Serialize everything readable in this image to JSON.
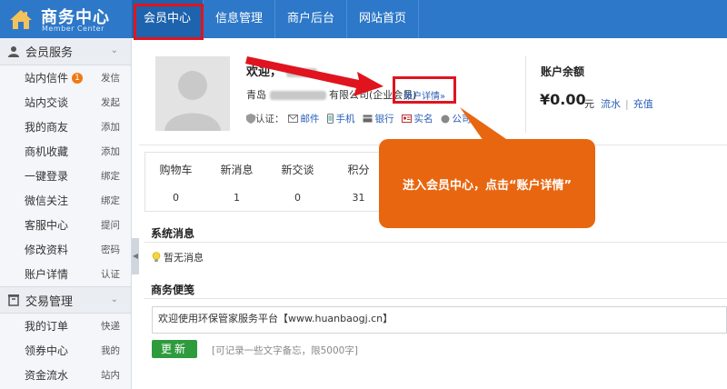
{
  "header": {
    "logo_title": "商务中心",
    "logo_subtitle": "Member Center",
    "tabs": [
      {
        "label": "会员中心",
        "active": true
      },
      {
        "label": "信息管理",
        "active": false
      },
      {
        "label": "商户后台",
        "active": false
      },
      {
        "label": "网站首页",
        "active": false
      }
    ],
    "bg_color": "#2d78c8"
  },
  "sidebar": {
    "sections": [
      {
        "title": "会员服务",
        "items": [
          {
            "label": "站内信件",
            "badge": "1",
            "action": "发信"
          },
          {
            "label": "站内交谈",
            "action": "发起"
          },
          {
            "label": "我的商友",
            "action": "添加"
          },
          {
            "label": "商机收藏",
            "action": "添加"
          },
          {
            "label": "一键登录",
            "action": "绑定"
          },
          {
            "label": "微信关注",
            "action": "绑定"
          },
          {
            "label": "客服中心",
            "action": "提问"
          },
          {
            "label": "修改资料",
            "action": "密码"
          },
          {
            "label": "账户详情",
            "action": "认证"
          }
        ]
      },
      {
        "title": "交易管理",
        "items": [
          {
            "label": "我的订单",
            "action": "快递"
          },
          {
            "label": "领券中心",
            "action": "我的"
          },
          {
            "label": "资金流水",
            "action": "站内"
          }
        ]
      }
    ]
  },
  "profile": {
    "welcome": "欢迎，",
    "company_prefix": "青岛",
    "company_suffix": "有限公司(企业会员)",
    "account_link": "账户详情»",
    "cert_label": "认证：",
    "certs": [
      "邮件",
      "手机",
      "银行",
      "实名",
      "公司"
    ]
  },
  "balance": {
    "title": "账户余额",
    "amount": "¥0.00",
    "unit": "元",
    "link_flow": "流水",
    "separator": "|",
    "link_recharge": "充值"
  },
  "stats": [
    {
      "label": "购物车",
      "value": "0"
    },
    {
      "label": "新消息",
      "value": "1"
    },
    {
      "label": "新交谈",
      "value": "0"
    },
    {
      "label": "积分",
      "value": "31"
    }
  ],
  "system_msg": {
    "title": "系统消息",
    "empty": "暂无消息"
  },
  "memo": {
    "title": "商务便笺",
    "content": "欢迎使用环保管家服务平台【www.huanbaogj.cn】",
    "button": "更新",
    "hint": "[可记录一些文字备忘，限5000字]"
  },
  "annotation": {
    "callout_text": "进入会员中心，点击“账户详情”",
    "callout_color": "#e8660f",
    "highlight_color": "#e0141e"
  }
}
